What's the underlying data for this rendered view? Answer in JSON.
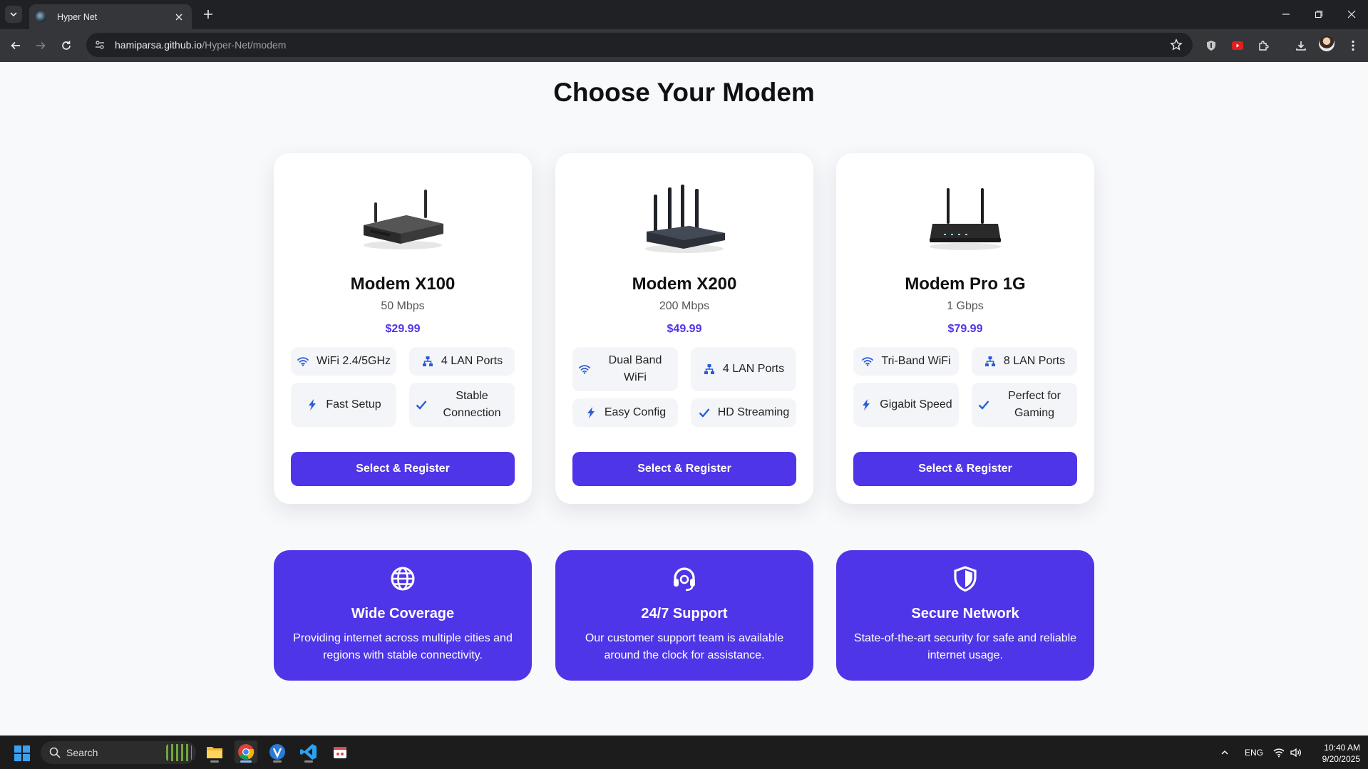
{
  "browser": {
    "tab_title": "Hyper Net",
    "url_host": "hamiparsa.github.io",
    "url_path": "/Hyper-Net/modem"
  },
  "page": {
    "title": "Choose Your Modem"
  },
  "modems": [
    {
      "name": "Modem X100",
      "speed": "50 Mbps",
      "price": "$29.99",
      "features": [
        {
          "icon": "wifi-icon",
          "label": "WiFi 2.4/5GHz"
        },
        {
          "icon": "network-icon",
          "label": "4 LAN Ports"
        },
        {
          "icon": "bolt-icon",
          "label": "Fast Setup"
        },
        {
          "icon": "check-icon",
          "label": "Stable Connection"
        }
      ],
      "button": "Select & Register"
    },
    {
      "name": "Modem X200",
      "speed": "200 Mbps",
      "price": "$49.99",
      "features": [
        {
          "icon": "wifi-icon",
          "label": "Dual Band WiFi"
        },
        {
          "icon": "network-icon",
          "label": "4 LAN Ports"
        },
        {
          "icon": "bolt-icon",
          "label": "Easy Config"
        },
        {
          "icon": "check-icon",
          "label": "HD Streaming"
        }
      ],
      "button": "Select & Register"
    },
    {
      "name": "Modem Pro 1G",
      "speed": "1 Gbps",
      "price": "$79.99",
      "features": [
        {
          "icon": "wifi-icon",
          "label": "Tri-Band WiFi"
        },
        {
          "icon": "network-icon",
          "label": "8 LAN Ports"
        },
        {
          "icon": "bolt-icon",
          "label": "Gigabit Speed"
        },
        {
          "icon": "check-icon",
          "label": "Perfect for Gaming"
        }
      ],
      "button": "Select & Register"
    }
  ],
  "info_cards": [
    {
      "icon": "globe-icon",
      "title": "Wide Coverage",
      "text": "Providing internet across multiple cities and regions with stable connectivity."
    },
    {
      "icon": "headset-icon",
      "title": "24/7 Support",
      "text": "Our customer support team is available around the clock for assistance."
    },
    {
      "icon": "shield-icon",
      "title": "Secure Network",
      "text": "State-of-the-art security for safe and reliable internet usage."
    }
  ],
  "taskbar": {
    "search_placeholder": "Search",
    "language": "ENG",
    "time": "10:40 AM",
    "date": "9/20/2025"
  },
  "colors": {
    "accent": "#4f35e8",
    "feature_icon": "#2a5cd8",
    "chrome_dark": "#202124"
  }
}
